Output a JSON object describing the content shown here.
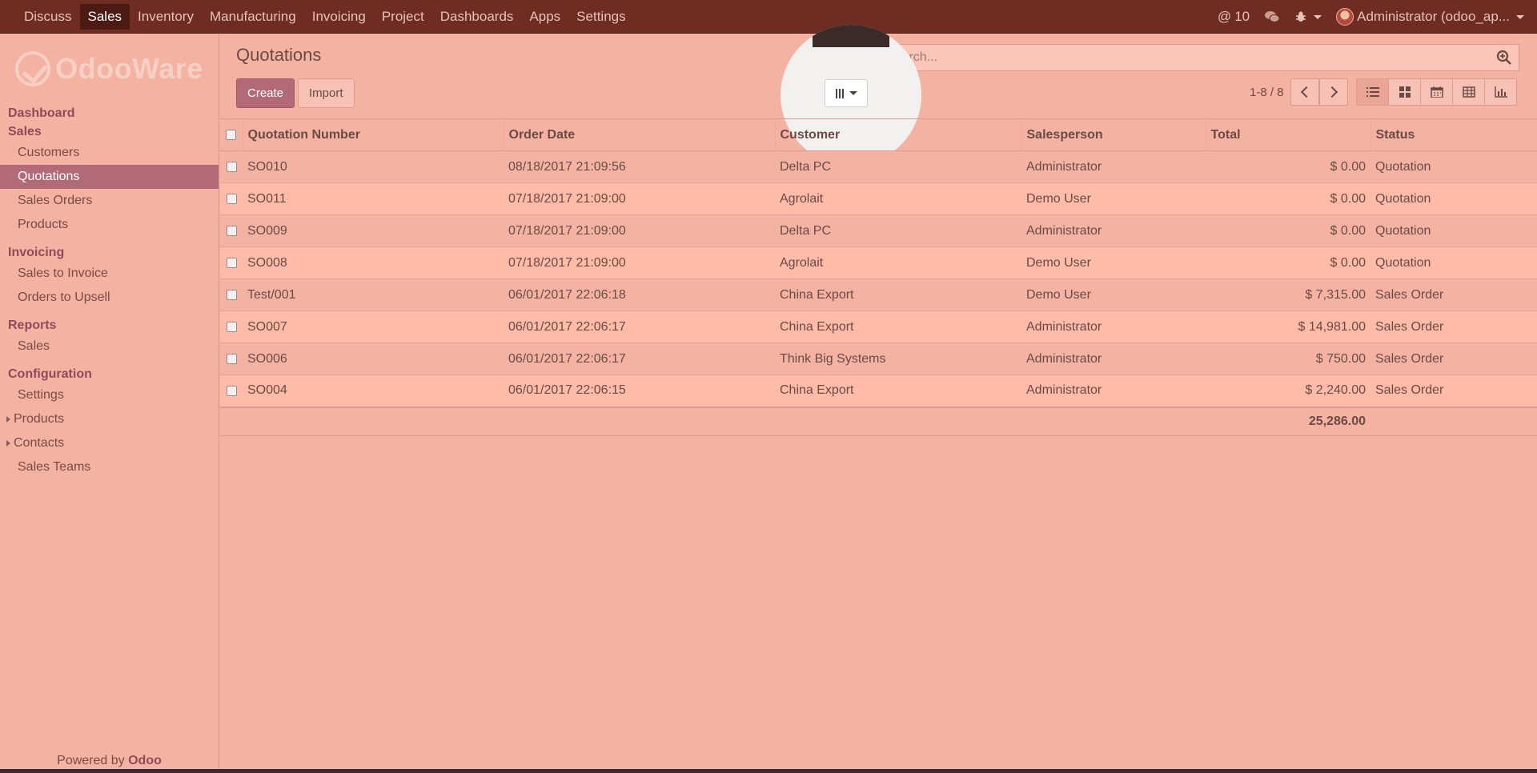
{
  "topnav": {
    "menu": [
      "Discuss",
      "Sales",
      "Inventory",
      "Manufacturing",
      "Invoicing",
      "Project",
      "Dashboards",
      "Apps",
      "Settings"
    ],
    "active": "Sales",
    "mentions_count": "10",
    "user": "Administrator (odoo_ap..."
  },
  "sidebar": {
    "logo": "OdooWare",
    "dashboard": "Dashboard",
    "sales_section": "Sales",
    "sales_items": [
      "Customers",
      "Quotations",
      "Sales Orders",
      "Products"
    ],
    "invoicing_section": "Invoicing",
    "invoicing_items": [
      "Sales to Invoice",
      "Orders to Upsell"
    ],
    "reports_section": "Reports",
    "reports_items": [
      "Sales"
    ],
    "configuration_section": "Configuration",
    "config_settings": "Settings",
    "config_products": "Products",
    "config_contacts": "Contacts",
    "config_sales_teams": "Sales Teams",
    "powered_by": "Powered by",
    "powered_brand": "Odoo"
  },
  "control": {
    "title": "Quotations",
    "create": "Create",
    "import": "Import",
    "search_placeholder": "Search...",
    "pager": "1-8 / 8"
  },
  "table": {
    "headers": [
      "Quotation Number",
      "Order Date",
      "Customer",
      "Salesperson",
      "Total",
      "Status"
    ],
    "rows": [
      [
        "SO010",
        "08/18/2017 21:09:56",
        "Delta PC",
        "Administrator",
        "$ 0.00",
        "Quotation"
      ],
      [
        "SO011",
        "07/18/2017 21:09:00",
        "Agrolait",
        "Demo User",
        "$ 0.00",
        "Quotation"
      ],
      [
        "SO009",
        "07/18/2017 21:09:00",
        "Delta PC",
        "Administrator",
        "$ 0.00",
        "Quotation"
      ],
      [
        "SO008",
        "07/18/2017 21:09:00",
        "Agrolait",
        "Demo User",
        "$ 0.00",
        "Quotation"
      ],
      [
        "Test/001",
        "06/01/2017 22:06:18",
        "China Export",
        "Demo User",
        "$ 7,315.00",
        "Sales Order"
      ],
      [
        "SO007",
        "06/01/2017 22:06:17",
        "China Export",
        "Administrator",
        "$ 14,981.00",
        "Sales Order"
      ],
      [
        "SO006",
        "06/01/2017 22:06:17",
        "Think Big Systems",
        "Administrator",
        "$ 750.00",
        "Sales Order"
      ],
      [
        "SO004",
        "06/01/2017 22:06:15",
        "China Export",
        "Administrator",
        "$ 2,240.00",
        "Sales Order"
      ]
    ],
    "total": "25,286.00"
  },
  "colors": {
    "topbar": "#6e2c22",
    "accent": "#b36a78",
    "background": "#f4b3a2"
  }
}
